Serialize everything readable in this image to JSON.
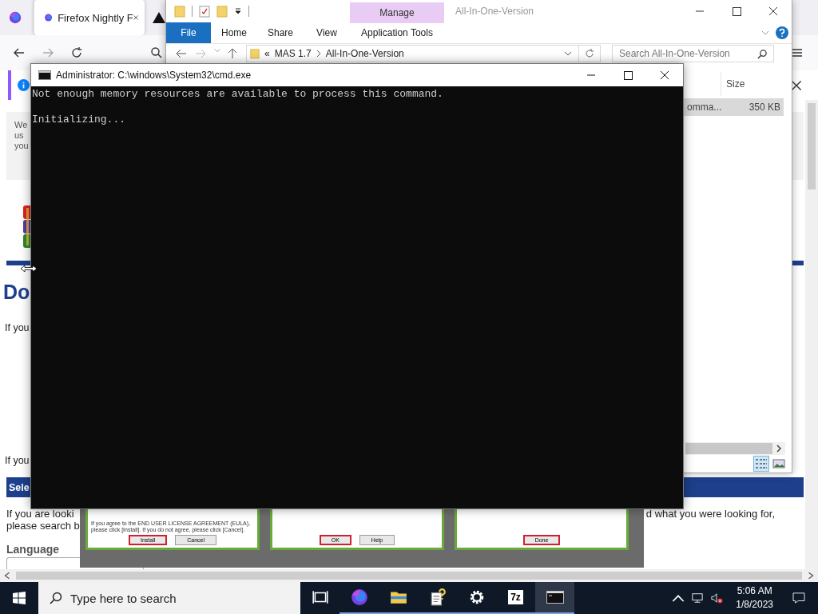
{
  "browser": {
    "tabs": [
      {
        "title": "Firefox Nightly F",
        "selected": true
      }
    ],
    "page": {
      "notice_lines": [
        "We",
        "us",
        "you"
      ],
      "heading": "Do",
      "paragraphs": [
        "If you",
        "If you"
      ],
      "section_title": "Sele",
      "intro_left": "If you are looki",
      "intro_right": "d what you were looking for,",
      "intro_line2": "please search b",
      "language_label": "Language"
    },
    "gallery": [
      {
        "text": "If you agree to the END USER LICENSE AGREEMENT (EULA), please click [Install]. If you do not agree, please click [Cancel].",
        "buttons": [
          {
            "label": "Install",
            "highlighted": true
          },
          {
            "label": "Cancel",
            "highlighted": false
          }
        ]
      },
      {
        "buttons": [
          {
            "label": "OK",
            "highlighted": true
          },
          {
            "label": "Help",
            "highlighted": false
          }
        ]
      },
      {
        "buttons": [
          {
            "label": "Done",
            "highlighted": true
          }
        ]
      }
    ]
  },
  "explorer": {
    "title": "All-In-One-Version",
    "context_tab": "Manage",
    "context_group": "Application Tools",
    "ribbon_tabs": [
      {
        "label": "File",
        "kind": "file"
      },
      {
        "label": "Home",
        "kind": "tab"
      },
      {
        "label": "Share",
        "kind": "tab"
      },
      {
        "label": "View",
        "kind": "tab"
      }
    ],
    "overflow": "«",
    "breadcrumb": [
      "MAS 1.7",
      "All-In-One-Version"
    ],
    "search_placeholder": "Search All-In-One-Version",
    "columns": [
      "Size"
    ],
    "files": [
      {
        "name": "omma...",
        "size": "350 KB",
        "selected": true
      }
    ],
    "views": [
      {
        "kind": "details",
        "selected": true
      },
      {
        "kind": "large_icons",
        "selected": false
      }
    ]
  },
  "cmd": {
    "title": "Administrator: C:\\windows\\System32\\cmd.exe",
    "lines": [
      {
        "text": "Not enough memory resources are available to process this command.",
        "gap_before": false
      },
      {
        "text": "Initializing...",
        "gap_before": true
      }
    ]
  },
  "taskbar": {
    "search_placeholder": "Type here to search",
    "apps": [
      {
        "kind": "task_view",
        "running": false,
        "active": false
      },
      {
        "kind": "firefox",
        "running": true,
        "active": false
      },
      {
        "kind": "explorer",
        "running": true,
        "active": false
      },
      {
        "kind": "help_doc",
        "running": true,
        "active": false
      },
      {
        "kind": "settings",
        "running": true,
        "active": false
      },
      {
        "kind": "archiver",
        "icon_text": "7z",
        "running": true,
        "active": false
      },
      {
        "kind": "terminal",
        "running": true,
        "active": true
      }
    ],
    "time": "5:06 AM",
    "date": "1/8/2023"
  }
}
